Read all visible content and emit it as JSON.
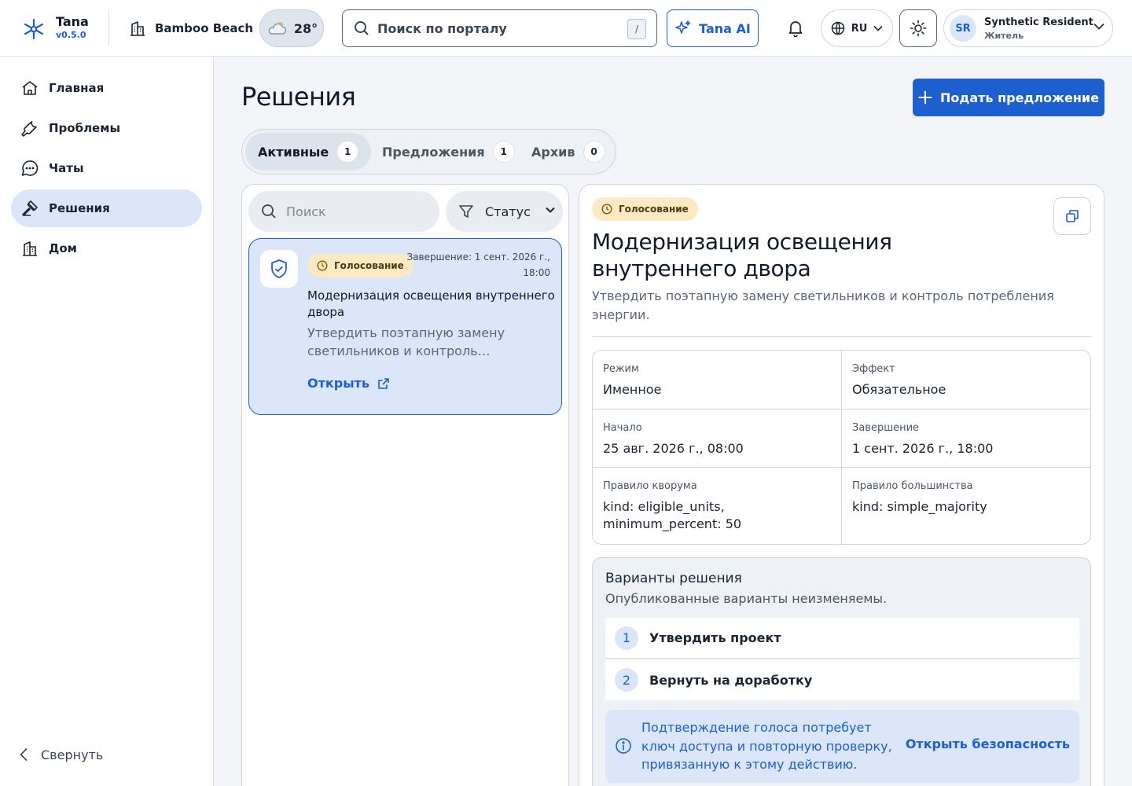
{
  "app": {
    "name": "Tana",
    "version": "v0.5.0"
  },
  "header": {
    "site_name": "Bamboo Beach",
    "weather_temp": "28°",
    "search_placeholder": "Поиск по порталу",
    "search_shortcut": "/",
    "ai_label": "Tana AI",
    "language": "RU",
    "user": {
      "initials": "SR",
      "name": "Synthetic Resident",
      "role": "Житель"
    }
  },
  "sidebar": {
    "items": [
      {
        "label": "Главная",
        "icon": "home-icon"
      },
      {
        "label": "Проблемы",
        "icon": "wrench-icon"
      },
      {
        "label": "Чаты",
        "icon": "chat-icon"
      },
      {
        "label": "Решения",
        "icon": "gavel-icon",
        "active": true
      },
      {
        "label": "Дом",
        "icon": "building-icon"
      }
    ],
    "collapse_label": "Свернуть"
  },
  "main": {
    "title": "Решения",
    "primary_action": "Подать предложение",
    "tabs": [
      {
        "label": "Активные",
        "count": "1",
        "active": true
      },
      {
        "label": "Предложения",
        "count": "1"
      },
      {
        "label": "Архив",
        "count": "0"
      }
    ],
    "list": {
      "search_placeholder": "Поиск",
      "status_filter": "Статус",
      "cards": [
        {
          "badge": "Голосование",
          "end": "Завершение: 1 сент. 2026 г., 18:00",
          "title": "Модернизация освещения внутреннего двора",
          "description": "Утвердить поэтапную замену светильников и контроль потребления энергии.",
          "open_label": "Открыть"
        }
      ]
    },
    "detail": {
      "badge": "Голосование",
      "title": "Модернизация освещения внутреннего двора",
      "description": "Утвердить поэтапную замену светильников и контроль потребления энергии.",
      "fields": [
        {
          "label": "Режим",
          "value": "Именное"
        },
        {
          "label": "Эффект",
          "value": "Обязательное"
        },
        {
          "label": "Начало",
          "value": "25 авг. 2026 г., 08:00"
        },
        {
          "label": "Завершение",
          "value": "1 сент. 2026 г., 18:00"
        },
        {
          "label": "Правило кворума",
          "value": "kind: eligible_units, minimum_percent: 50"
        },
        {
          "label": "Правило большинства",
          "value": "kind: simple_majority"
        }
      ],
      "options_title": "Варианты решения",
      "options_subtitle": "Опубликованные варианты неизменяемы.",
      "options": [
        {
          "num": "1",
          "label": "Утвердить проект"
        },
        {
          "num": "2",
          "label": "Вернуть на доработку"
        }
      ],
      "alert_text": "Подтверждение голоса потребует ключ доступа и повторную проверку, привязанную к этому действию.",
      "alert_link": "Открыть безопасность"
    }
  },
  "colors": {
    "accent": "#1d5fcf",
    "active_bg": "#dbe6f8",
    "badge_bg": "#fde9c4"
  }
}
